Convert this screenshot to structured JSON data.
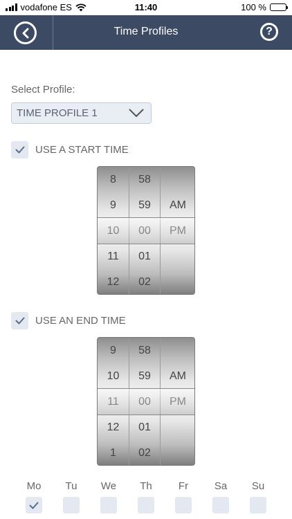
{
  "status_bar": {
    "carrier": "vodafone ES",
    "time": "11:40",
    "battery": "100 %"
  },
  "header": {
    "title": "Time Profiles"
  },
  "colors": {
    "header_bg": "#3d4a63",
    "accent": "#5b6d8c",
    "control_bg": "#e4e9f1"
  },
  "profile": {
    "label": "Select Profile:",
    "selected": "TIME PROFILE 1"
  },
  "start_time": {
    "label": "USE A START TIME",
    "checked": true,
    "hours": [
      "8",
      "9",
      "10",
      "11",
      "12"
    ],
    "minutes": [
      "58",
      "59",
      "00",
      "01",
      "02"
    ],
    "ampm": [
      "",
      "AM",
      "PM",
      "",
      ""
    ]
  },
  "end_time": {
    "label": "USE AN END TIME",
    "checked": true,
    "hours": [
      "9",
      "10",
      "11",
      "12",
      "1"
    ],
    "minutes": [
      "58",
      "59",
      "00",
      "01",
      "02"
    ],
    "ampm": [
      "",
      "AM",
      "PM",
      "",
      ""
    ]
  },
  "days": [
    {
      "label": "Mo",
      "checked": true
    },
    {
      "label": "Tu",
      "checked": false
    },
    {
      "label": "We",
      "checked": false
    },
    {
      "label": "Th",
      "checked": false
    },
    {
      "label": "Fr",
      "checked": false
    },
    {
      "label": "Sa",
      "checked": false
    },
    {
      "label": "Su",
      "checked": false
    }
  ]
}
